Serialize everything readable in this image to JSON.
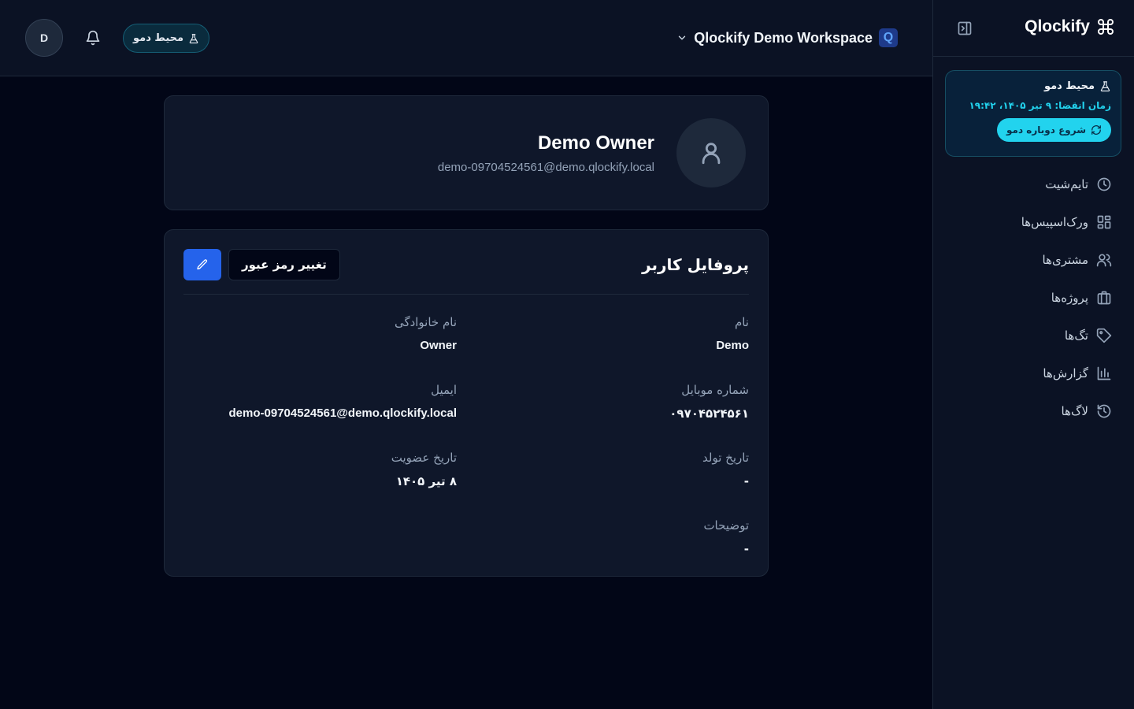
{
  "sidebar": {
    "brand": "Qlockify",
    "demo": {
      "title": "محیط دمو",
      "expires": "زمان انقضا: ۹ تیر ۱۴۰۵، ۱۹:۴۲",
      "restart_label": "شروع دوباره دمو"
    },
    "items": [
      {
        "label": "تایم‌شیت",
        "icon": "clock-icon"
      },
      {
        "label": "ورک‌اسپیس‌ها",
        "icon": "grid-icon"
      },
      {
        "label": "مشتری‌ها",
        "icon": "users-icon"
      },
      {
        "label": "پروژه‌ها",
        "icon": "briefcase-icon"
      },
      {
        "label": "تگ‌ها",
        "icon": "tag-icon"
      },
      {
        "label": "گزارش‌ها",
        "icon": "bar-chart-icon"
      },
      {
        "label": "لاگ‌ها",
        "icon": "history-icon"
      }
    ]
  },
  "header": {
    "avatar_initial": "D",
    "demo_pill": "محیط دمو",
    "workspace_name": "Qlockify Demo Workspace",
    "workspace_badge": "Q"
  },
  "user": {
    "name": "Demo Owner",
    "email": "demo-09704524561@demo.qlockify.local"
  },
  "profile": {
    "title": "پروفایل کاربر",
    "change_password_label": "تغییر رمز عبور",
    "fields": {
      "first_name": {
        "label": "نام",
        "value": "Demo"
      },
      "last_name": {
        "label": "نام خانوادگی",
        "value": "Owner"
      },
      "mobile": {
        "label": "شماره موبایل",
        "value": "۰۹۷۰۴۵۲۴۵۶۱"
      },
      "email": {
        "label": "ایمیل",
        "value": "demo-09704524561@demo.qlockify.local"
      },
      "birthdate": {
        "label": "تاریخ تولد",
        "value": "-"
      },
      "joined": {
        "label": "تاریخ عضویت",
        "value": "۸ تیر ۱۴۰۵"
      },
      "notes": {
        "label": "توضیحات",
        "value": "-"
      }
    }
  },
  "colors": {
    "background": "#020617",
    "panel": "#0f172a",
    "accent": "#2563eb",
    "demo_accent": "#22d3ee"
  }
}
